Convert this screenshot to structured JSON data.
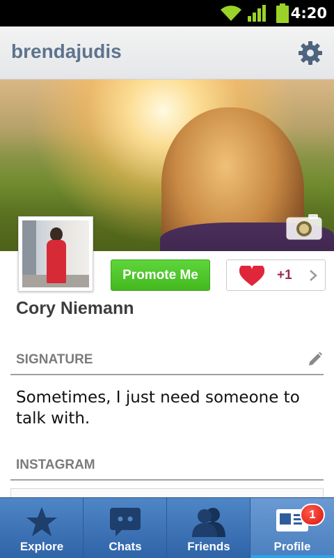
{
  "status_bar": {
    "time": "4:20"
  },
  "header": {
    "title": "brendajudis"
  },
  "profile": {
    "name": "Cory Niemann",
    "promote_label": "Promote Me",
    "like_count": "+1"
  },
  "sections": {
    "signature": {
      "title": "SIGNATURE",
      "text": "Sometimes, I just need someone to talk with."
    },
    "instagram": {
      "title": "INSTAGRAM"
    }
  },
  "tabs": [
    {
      "label": "Explore",
      "icon": "star-icon"
    },
    {
      "label": "Chats",
      "icon": "chat-bubble-icon"
    },
    {
      "label": "Friends",
      "icon": "friends-icon"
    },
    {
      "label": "Profile",
      "icon": "profile-card-icon",
      "active": true
    }
  ],
  "badge": {
    "count": "1"
  },
  "colors": {
    "header_title": "#5e738e",
    "promote_green": "#4cc428",
    "heart_red": "#e0263a",
    "tab_blue": "#3f74b6",
    "badge_red": "#d8170e"
  }
}
